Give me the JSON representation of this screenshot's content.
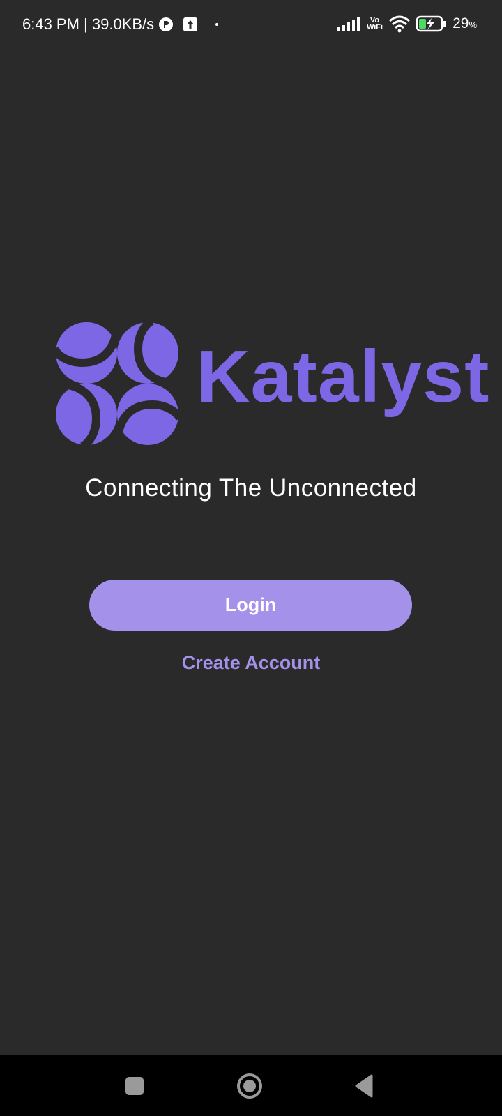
{
  "status_bar": {
    "time_speed": "6:43 PM | 39.0KB/s",
    "vo": "Vo",
    "wifi_label": "WiFi",
    "battery_percent": "29",
    "battery_unit": "%",
    "icons": [
      "app-notification-icon",
      "upload-icon",
      "signal-icon",
      "wifi-icon",
      "battery-charging-icon"
    ]
  },
  "brand": {
    "name": "Katalyst",
    "tagline": "Connecting The Unconnected",
    "color": "#7e67e4"
  },
  "actions": {
    "login_label": "Login",
    "create_account_label": "Create Account",
    "accent": "#a391ea"
  },
  "nav": {
    "icons": [
      "recents-square-icon",
      "home-circle-icon",
      "back-triangle-icon"
    ]
  }
}
